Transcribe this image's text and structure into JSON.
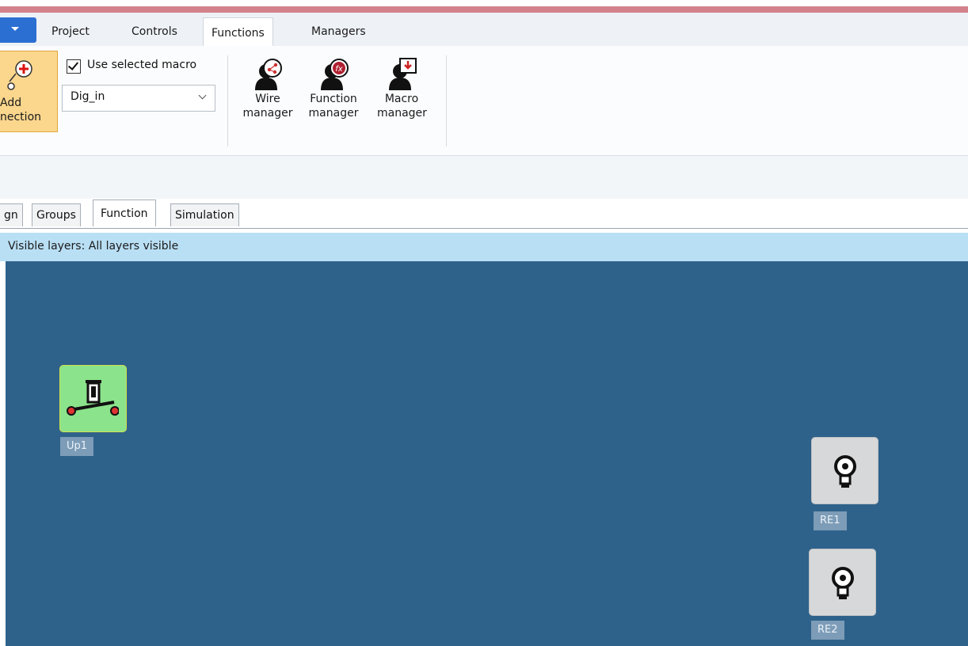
{
  "ribbon": {
    "tabs": [
      "Project",
      "Controls",
      "Functions",
      "Managers"
    ],
    "active_tab": "Functions",
    "add_connection": {
      "line1": "Add",
      "line2": "nection"
    },
    "use_selected_macro": {
      "label": "Use selected macro",
      "checked": true
    },
    "macro_select": {
      "value": "Dig_in"
    },
    "managers": [
      {
        "line1": "Wire",
        "line2": "manager",
        "icon": "wire-manager-icon"
      },
      {
        "line1": "Function",
        "line2": "manager",
        "icon": "function-manager-icon"
      },
      {
        "line1": "Macro",
        "line2": "manager",
        "icon": "macro-manager-icon"
      }
    ]
  },
  "doc_tabs": [
    "gn",
    "Groups",
    "Function",
    "Simulation"
  ],
  "active_doc_tab": "Function",
  "layers": {
    "text": "Visible layers: All layers visible"
  },
  "canvas": {
    "background": "#2e628b",
    "nodes": [
      {
        "label": "Up1",
        "icon": "up-switch-icon",
        "color": "#8be38b"
      },
      {
        "label": "RE1",
        "icon": "relay-lamp-icon",
        "color": "#d7d8da"
      },
      {
        "label": "RE2",
        "icon": "relay-lamp-icon",
        "color": "#d7d8da"
      }
    ]
  }
}
